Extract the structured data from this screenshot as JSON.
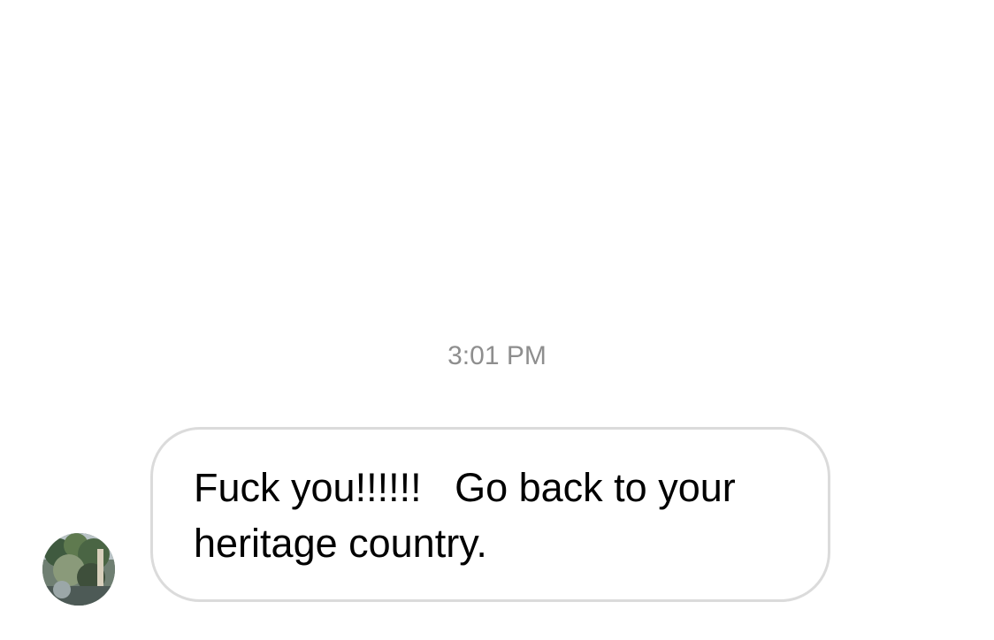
{
  "conversation": {
    "timestamp": "3:01 PM",
    "messages": [
      {
        "direction": "incoming",
        "text": "Fuck you!!!!!!   Go back to your heritage country."
      }
    ]
  },
  "colors": {
    "background": "#ffffff",
    "timestamp_text": "#8e8e8e",
    "bubble_border": "#dbdbdb",
    "message_text": "#000000"
  }
}
